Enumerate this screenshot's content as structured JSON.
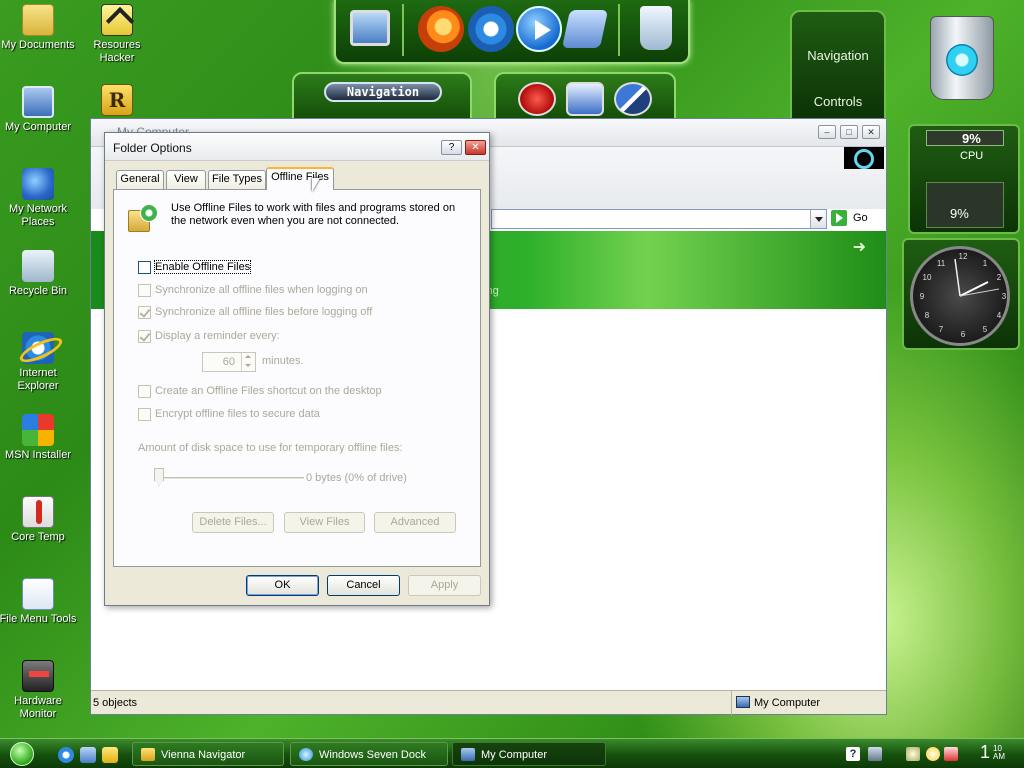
{
  "desktop": {
    "icons": [
      {
        "label": "My Documents"
      },
      {
        "label": "Resoures Hacker"
      },
      {
        "label": "My Computer"
      },
      {
        "label": "My Network Places"
      },
      {
        "label": "Recycle Bin"
      },
      {
        "label": "Internet Explorer"
      },
      {
        "label": "MSN Installer"
      },
      {
        "label": "Core Temp"
      },
      {
        "label": "File Menu Tools"
      },
      {
        "label": "Hardware Monitor"
      }
    ]
  },
  "dock": {
    "icons": [
      "computer-icon",
      "firefox-icon",
      "internet-explorer-icon",
      "media-player-icon",
      "settings-icon",
      "recycle-bin-icon"
    ],
    "navigation_label": "Navigation"
  },
  "side_panel": {
    "navigation": "Navigation",
    "controls": "Controls"
  },
  "cpu_meter": {
    "cpu1": "9%",
    "label": "CPU",
    "cpu2": "9%"
  },
  "clock": {
    "numbers": [
      "12",
      "1",
      "2",
      "3",
      "4",
      "5",
      "6",
      "7",
      "8",
      "9",
      "10",
      "11"
    ]
  },
  "my_computer_window": {
    "title": "My Computer",
    "go_label": "Go",
    "banner_text": "ting",
    "status_left": "5 objects",
    "status_right": "My Computer"
  },
  "folder_options": {
    "title": "Folder Options",
    "tabs": [
      "General",
      "View",
      "File Types",
      "Offline Files"
    ],
    "active_tab": "Offline Files",
    "intro": "Use Offline Files to work with files and programs stored on the network even when you are not connected.",
    "options": {
      "enable": "Enable Offline Files",
      "sync_logon": "Synchronize all offline files when logging on",
      "sync_logoff": "Synchronize all offline files before logging off",
      "reminder": "Display a reminder every:",
      "reminder_minutes": "60",
      "minutes_label": "minutes.",
      "shortcut": "Create an Offline Files shortcut on the desktop",
      "encrypt": "Encrypt offline files to secure data"
    },
    "disk_label": "Amount of disk space to use for temporary offline files:",
    "disk_value": "0 bytes (0% of drive)",
    "actions": {
      "delete": "Delete Files...",
      "view": "View Files",
      "advanced": "Advanced"
    },
    "buttons": {
      "ok": "OK",
      "cancel": "Cancel",
      "apply": "Apply"
    }
  },
  "taskbar": {
    "tasks": [
      "Vienna Navigator",
      "Windows Seven Dock",
      "My Computer"
    ],
    "time_hour": "1",
    "time_minutes": "10",
    "time_ampm": "AM"
  },
  "colors": {
    "accent": "#3a9c20",
    "title_active": "#f9b43a",
    "disabled_text": "#aca899"
  }
}
